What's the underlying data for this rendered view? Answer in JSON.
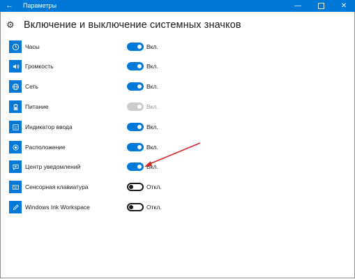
{
  "window": {
    "title": "Параметры",
    "back_icon": "arrow-left-icon",
    "minimize_icon": "minimize-icon",
    "maximize_icon": "maximize-icon",
    "close_icon": "close-icon",
    "accent": "#0078d7"
  },
  "page": {
    "icon": "gear-icon",
    "title": "Включение и выключение системных значков"
  },
  "items": [
    {
      "icon": "clock-icon",
      "label": "Часы",
      "state": "Вкл.",
      "toggle": "on"
    },
    {
      "icon": "volume-icon",
      "label": "Громкость",
      "state": "Вкл.",
      "toggle": "on"
    },
    {
      "icon": "network-icon",
      "label": "Сеть",
      "state": "Вкл.",
      "toggle": "on"
    },
    {
      "icon": "battery-icon",
      "label": "Питание",
      "state": "Вкл.",
      "toggle": "disabled"
    },
    {
      "icon": "keyboard-input-icon",
      "label": "Индикатор ввода",
      "state": "Вкл.",
      "toggle": "on"
    },
    {
      "icon": "location-icon",
      "label": "Расположение",
      "state": "Вкл.",
      "toggle": "on"
    },
    {
      "icon": "action-center-icon",
      "label": "Центр уведомлений",
      "state": "Вкл.",
      "toggle": "on"
    },
    {
      "icon": "touch-keyboard-icon",
      "label": "Сенсорная клавиатура",
      "state": "Откл.",
      "toggle": "off"
    },
    {
      "icon": "pen-ink-icon",
      "label": "Windows Ink Workspace",
      "state": "Откл.",
      "toggle": "off"
    }
  ]
}
